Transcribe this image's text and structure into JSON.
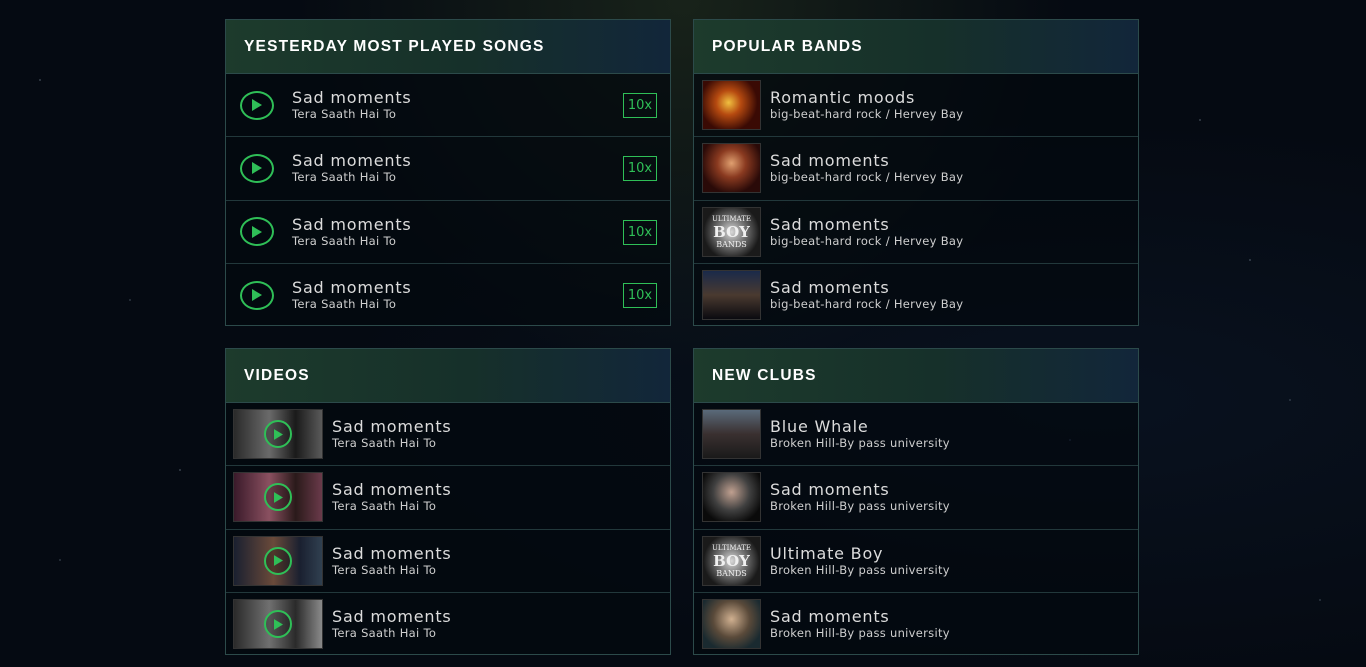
{
  "colors": {
    "accent": "#2fbf57",
    "panel_border": "#2c4a4a"
  },
  "songs": {
    "heading": "YESTERDAY MOST PLAYED SONGS",
    "items": [
      {
        "title": "Sad moments",
        "subtitle": "Tera Saath Hai To",
        "count": "10x"
      },
      {
        "title": "Sad moments",
        "subtitle": "Tera Saath Hai To",
        "count": "10x"
      },
      {
        "title": "Sad moments",
        "subtitle": "Tera Saath Hai To",
        "count": "10x"
      },
      {
        "title": "Sad moments",
        "subtitle": "Tera Saath Hai To",
        "count": "10x"
      }
    ]
  },
  "bands": {
    "heading": "POPULAR BANDS",
    "items": [
      {
        "title": "Romantic moods",
        "subtitle": "big-beat-hard rock / Hervey Bay"
      },
      {
        "title": "Sad moments",
        "subtitle": "big-beat-hard rock / Hervey Bay"
      },
      {
        "title": "Sad moments",
        "subtitle": "big-beat-hard rock / Hervey Bay",
        "logo": [
          "ULTIMATE",
          "BOY",
          "BANDS"
        ]
      },
      {
        "title": "Sad moments",
        "subtitle": "big-beat-hard rock / Hervey Bay"
      }
    ]
  },
  "videos": {
    "heading": "VIDEOS",
    "items": [
      {
        "title": "Sad moments",
        "subtitle": "Tera Saath Hai To"
      },
      {
        "title": "Sad moments",
        "subtitle": "Tera Saath Hai To"
      },
      {
        "title": "Sad moments",
        "subtitle": "Tera Saath Hai To"
      },
      {
        "title": "Sad moments",
        "subtitle": "Tera Saath Hai To"
      }
    ]
  },
  "clubs": {
    "heading": "NEW CLUBS",
    "items": [
      {
        "title": "Blue Whale",
        "subtitle": "Broken Hill-By pass university"
      },
      {
        "title": "Sad moments",
        "subtitle": "Broken Hill-By pass university"
      },
      {
        "title": "Ultimate Boy",
        "subtitle": "Broken Hill-By pass university",
        "logo": [
          "ULTIMATE",
          "BOY",
          "BANDS"
        ]
      },
      {
        "title": "Sad moments",
        "subtitle": "Broken Hill-By pass university"
      }
    ]
  }
}
